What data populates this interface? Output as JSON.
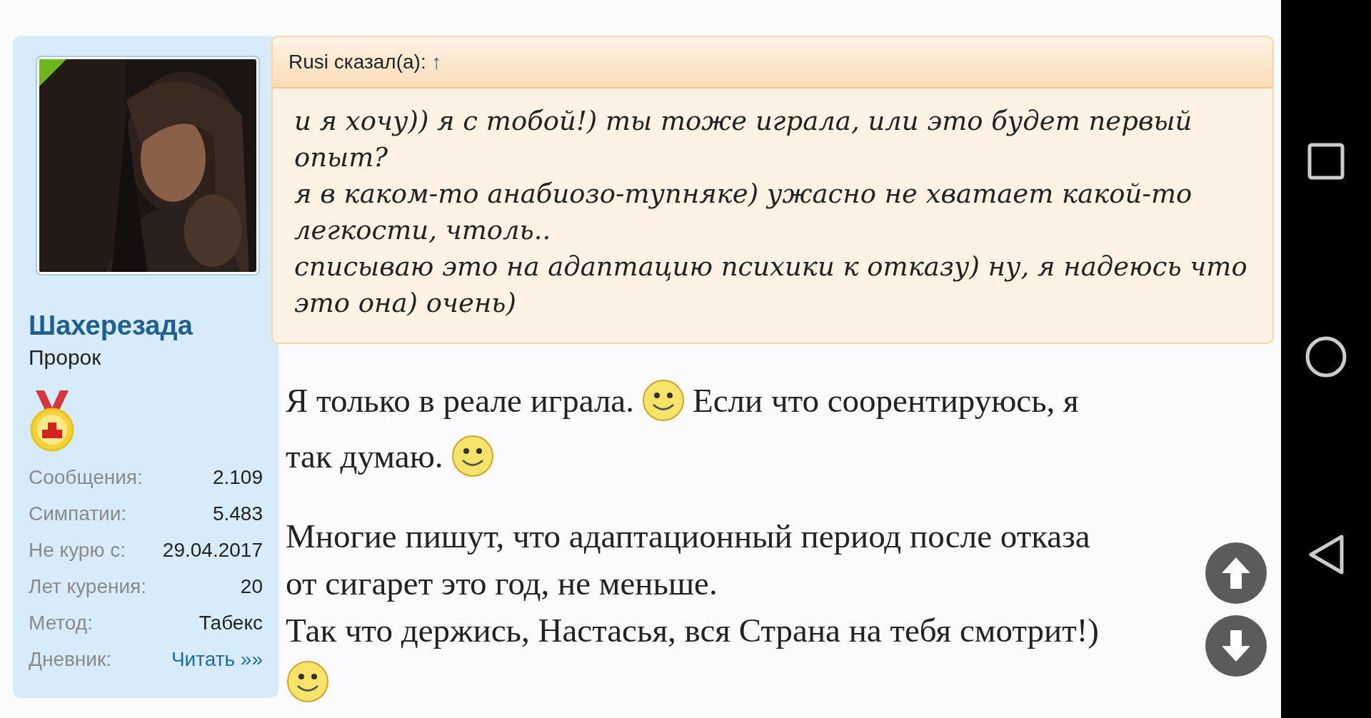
{
  "user": {
    "name": "Шахерезада",
    "title": "Пророк",
    "stats": [
      {
        "label": "Сообщения:",
        "value": "2.109",
        "kind": "text"
      },
      {
        "label": "Симпатии:",
        "value": "5.483",
        "kind": "text"
      },
      {
        "label": "Не курю с:",
        "value": "29.04.2017",
        "kind": "text"
      },
      {
        "label": "Лет курения:",
        "value": "20",
        "kind": "text"
      },
      {
        "label": "Метод:",
        "value": "Табекс",
        "kind": "text"
      },
      {
        "label": "Дневник:",
        "value": "Читать »»",
        "kind": "link"
      }
    ]
  },
  "quote": {
    "author": "Rusi сказал(а):",
    "jump": "↑",
    "paragraphs": [
      "и я хочу)) я с тобой!) ты тоже играла, или это будет первый опыт?",
      "я в каком-то анабиозо-тупняке) ужасно не хватает какой-то легкости, чтоль..",
      "списываю это на адаптацию психики к отказу) ну, я надеюсь что это она) очень)"
    ]
  },
  "message": [
    [
      [
        {
          "kind": "text",
          "text": "Я только в реале играла."
        },
        {
          "kind": "smiley"
        },
        {
          "kind": "text",
          "text": "Если что соорентируюсь, я"
        }
      ],
      [
        {
          "kind": "text",
          "text": "так думаю."
        },
        {
          "kind": "smiley"
        }
      ]
    ],
    [
      [
        {
          "kind": "text",
          "text": "Многие пишут, что адаптационный период после отказа"
        }
      ],
      [
        {
          "kind": "text",
          "text": "от сигарет это год, не меньше."
        }
      ],
      [
        {
          "kind": "text",
          "text": "Так что держись, Настасья, вся Страна на тебя смотрит!)"
        }
      ],
      [
        {
          "kind": "smiley"
        }
      ]
    ]
  ]
}
